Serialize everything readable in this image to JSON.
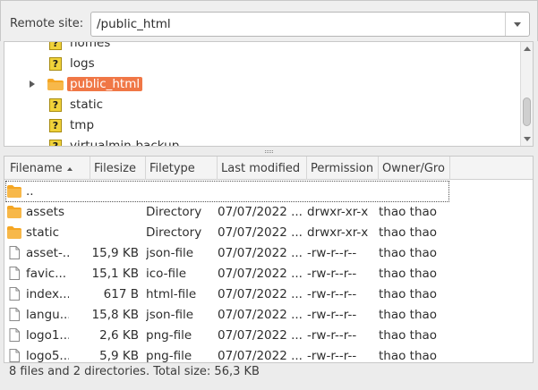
{
  "remote_site": {
    "label": "Remote site:",
    "path": "/public_html"
  },
  "tree": [
    {
      "name": "homes",
      "icon": "unknown-icon",
      "selected": false,
      "expandable": false
    },
    {
      "name": "logs",
      "icon": "unknown-icon",
      "selected": false,
      "expandable": false
    },
    {
      "name": "public_html",
      "icon": "folder-icon",
      "selected": true,
      "expandable": true
    },
    {
      "name": "static",
      "icon": "unknown-icon",
      "selected": false,
      "expandable": false
    },
    {
      "name": "tmp",
      "icon": "unknown-icon",
      "selected": false,
      "expandable": false
    },
    {
      "name": "virtualmin-backup",
      "icon": "unknown-icon",
      "selected": false,
      "expandable": false
    }
  ],
  "columns": {
    "filename": "Filename",
    "filesize": "Filesize",
    "filetype": "Filetype",
    "last_modified": "Last modified",
    "permissions": "Permission",
    "owner": "Owner/Gro"
  },
  "files": [
    {
      "name": "..",
      "size": "",
      "type": "",
      "modified": "",
      "perms": "",
      "owner": "",
      "icon": "folder-icon"
    },
    {
      "name": "assets",
      "size": "",
      "type": "Directory",
      "modified": "07/07/2022 ...",
      "perms": "drwxr-xr-x",
      "owner": "thao thao",
      "icon": "folder-icon"
    },
    {
      "name": "static",
      "size": "",
      "type": "Directory",
      "modified": "07/07/2022 ...",
      "perms": "drwxr-xr-x",
      "owner": "thao thao",
      "icon": "folder-icon"
    },
    {
      "name": "asset-...",
      "size": "15,9 KB",
      "type": "json-file",
      "modified": "07/07/2022 ...",
      "perms": "-rw-r--r--",
      "owner": "thao thao",
      "icon": "file-icon"
    },
    {
      "name": "favic...",
      "size": "15,1 KB",
      "type": "ico-file",
      "modified": "07/07/2022 ...",
      "perms": "-rw-r--r--",
      "owner": "thao thao",
      "icon": "file-icon"
    },
    {
      "name": "index...",
      "size": "617 B",
      "type": "html-file",
      "modified": "07/07/2022 ...",
      "perms": "-rw-r--r--",
      "owner": "thao thao",
      "icon": "file-icon"
    },
    {
      "name": "langu...",
      "size": "15,8 KB",
      "type": "json-file",
      "modified": "07/07/2022 ...",
      "perms": "-rw-r--r--",
      "owner": "thao thao",
      "icon": "file-icon"
    },
    {
      "name": "logo1...",
      "size": "2,6 KB",
      "type": "png-file",
      "modified": "07/07/2022 ...",
      "perms": "-rw-r--r--",
      "owner": "thao thao",
      "icon": "file-icon"
    },
    {
      "name": "logo5...",
      "size": "5,9 KB",
      "type": "png-file",
      "modified": "07/07/2022 ...",
      "perms": "-rw-r--r--",
      "owner": "thao thao",
      "icon": "file-icon"
    }
  ],
  "status": "8 files and 2 directories. Total size: 56,3 KB",
  "colors": {
    "selection": "#f07746",
    "folder": "#f5a623",
    "unknown_icon": "#f0d23a"
  }
}
